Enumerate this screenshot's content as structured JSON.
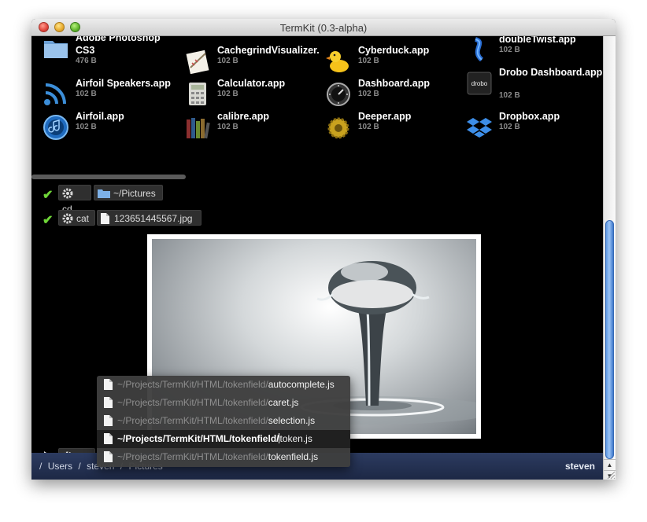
{
  "window": {
    "title": "TermKit (0.3-alpha)"
  },
  "files": [
    {
      "name": "Adobe Photoshop CS3",
      "size": "476 B",
      "icon": "folder-icon"
    },
    {
      "name": "CachegrindVisualizer.",
      "size": "102 B",
      "icon": "app-icon"
    },
    {
      "name": "Cyberduck.app",
      "size": "102 B",
      "icon": "duck-icon"
    },
    {
      "name": "doubleTwist.app",
      "size": "102 B",
      "icon": "twist-icon"
    },
    {
      "name": "Airfoil Speakers.app",
      "size": "102 B",
      "icon": "speaker-icon"
    },
    {
      "name": "Calculator.app",
      "size": "102 B",
      "icon": "calculator-icon"
    },
    {
      "name": "Dashboard.app",
      "size": "102 B",
      "icon": "dashboard-icon"
    },
    {
      "name": "Drobo Dashboard.app",
      "size": "102 B",
      "icon": "drobo-icon"
    },
    {
      "name": "Airfoil.app",
      "size": "102 B",
      "icon": "airfoil-icon"
    },
    {
      "name": "calibre.app",
      "size": "102 B",
      "icon": "books-icon"
    },
    {
      "name": "Deeper.app",
      "size": "102 B",
      "icon": "gear-gold-icon"
    },
    {
      "name": "Dropbox.app",
      "size": "102 B",
      "icon": "dropbox-icon"
    }
  ],
  "commands": [
    {
      "status": "done",
      "cmd": "cd",
      "arg": "~/Pictures"
    },
    {
      "status": "done",
      "cmd": "cat",
      "arg": "123651445567.jpg"
    }
  ],
  "prompt": {
    "cmd": "cat"
  },
  "autocomplete": [
    {
      "prefix": "~/Projects/TermKit/HTML/tokenfield/",
      "suffix": "autocomplete.js"
    },
    {
      "prefix": "~/Projects/TermKit/HTML/tokenfield/",
      "suffix": "caret.js"
    },
    {
      "prefix": "~/Projects/TermKit/HTML/tokenfield/",
      "suffix": "selection.js"
    },
    {
      "prefix": "~/Projects/TermKit/HTML/tokenfield/",
      "suffix": "token.js",
      "selected": true
    },
    {
      "prefix": "~/Projects/TermKit/HTML/tokenfield/",
      "suffix": "tokenfield.js"
    }
  ],
  "statusbar": {
    "sep": "/",
    "crumbs": [
      "Users",
      "steven",
      "Pictures"
    ],
    "user": "steven"
  }
}
